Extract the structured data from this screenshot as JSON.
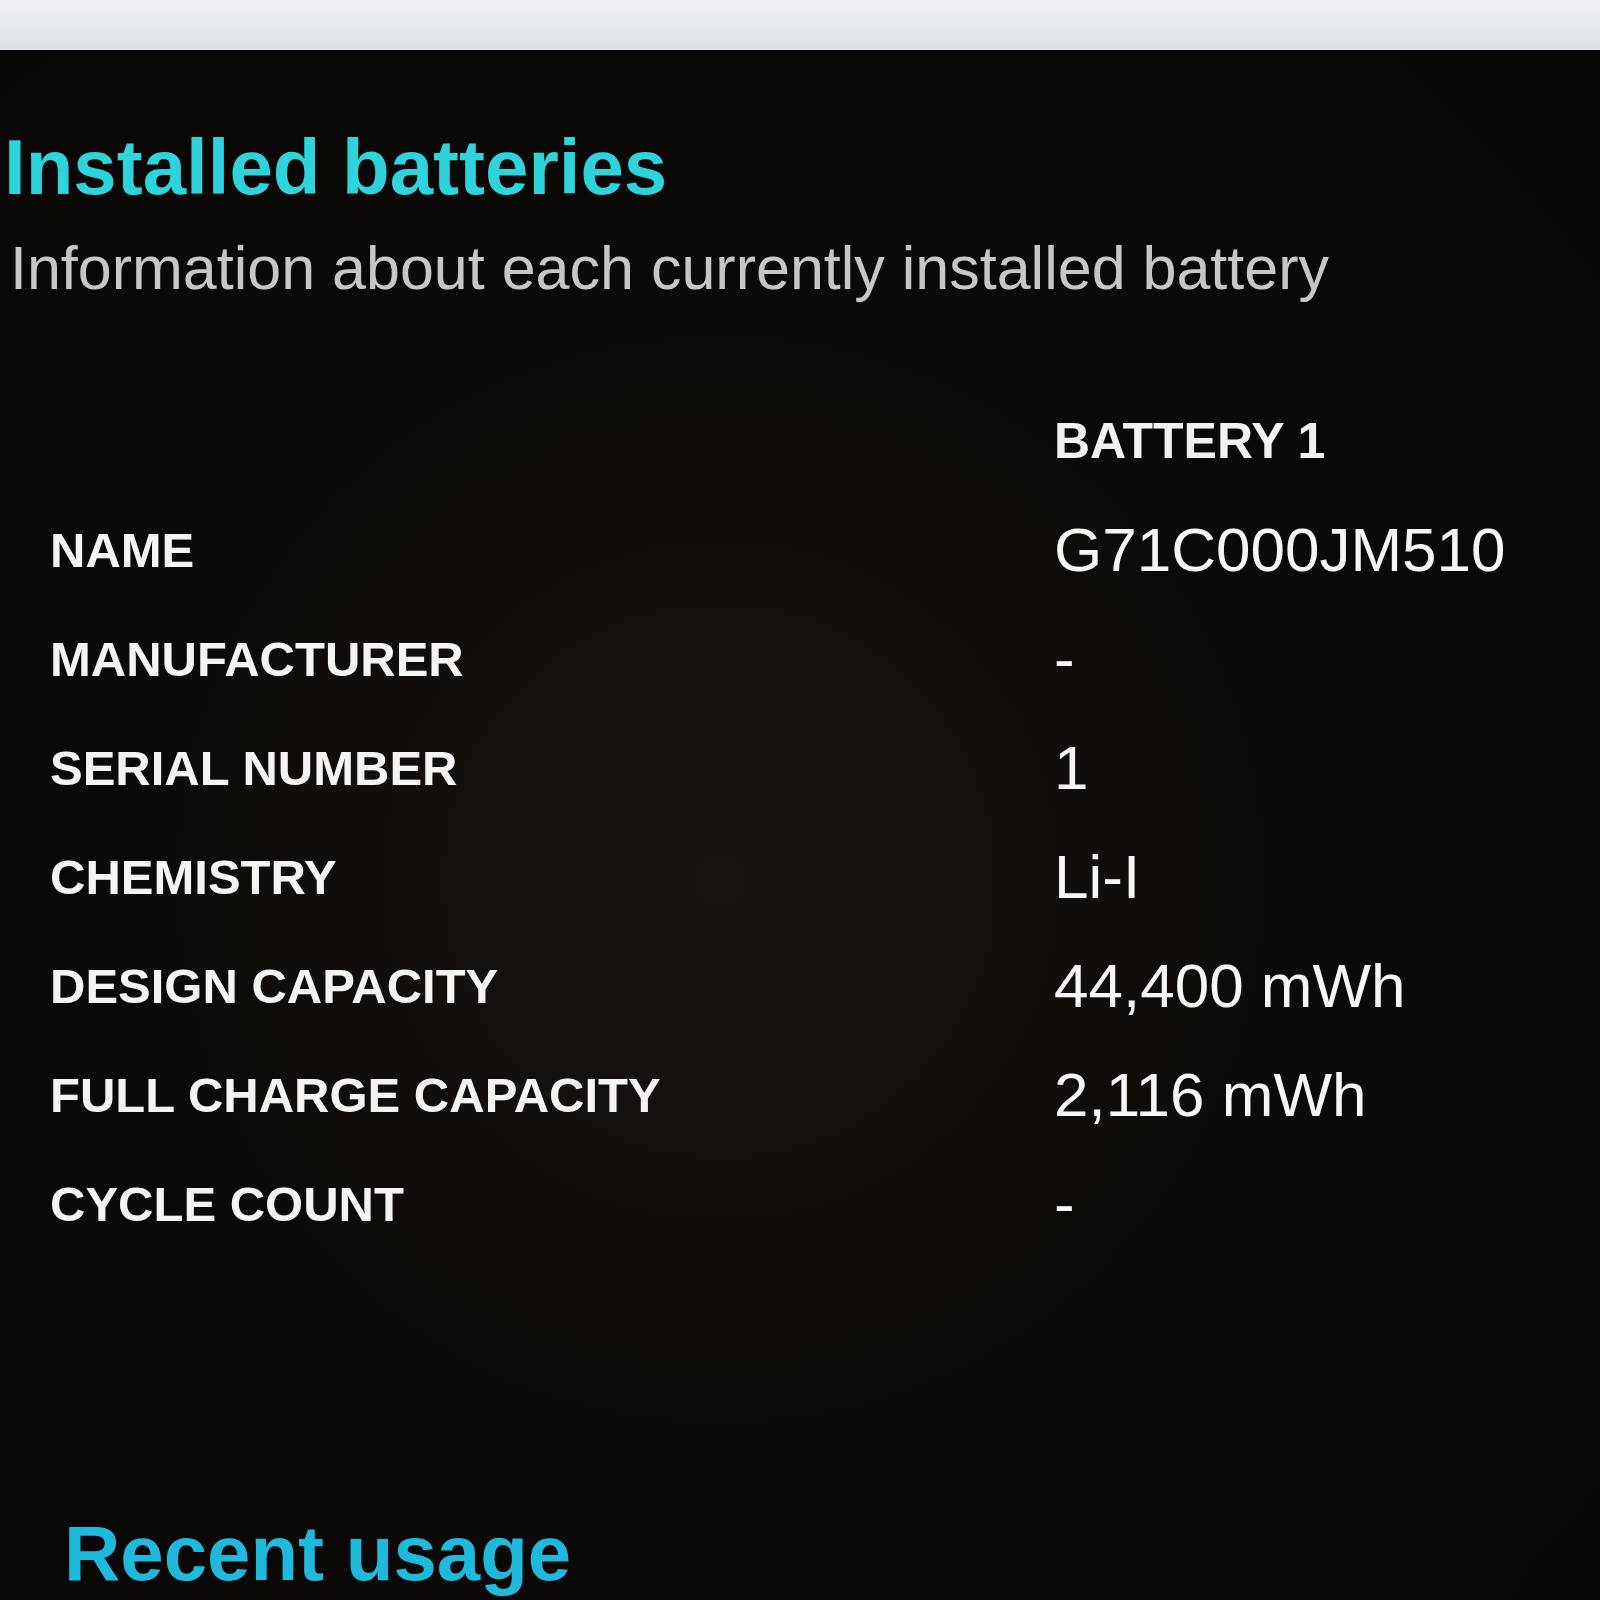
{
  "section": {
    "title": "Installed batteries",
    "subtitle": "Information about each currently installed battery"
  },
  "battery_table": {
    "columns": [
      "BATTERY 1"
    ],
    "rows": [
      {
        "label": "NAME",
        "value": "G71C000JM510"
      },
      {
        "label": "MANUFACTURER",
        "value": "-"
      },
      {
        "label": "SERIAL NUMBER",
        "value": "1"
      },
      {
        "label": "CHEMISTRY",
        "value": "Li-I"
      },
      {
        "label": "DESIGN CAPACITY",
        "value": "44,400 mWh"
      },
      {
        "label": "FULL CHARGE CAPACITY",
        "value": "2,116 mWh"
      },
      {
        "label": "CYCLE COUNT",
        "value": "-"
      }
    ]
  },
  "next_section": {
    "title": "Recent usage"
  }
}
